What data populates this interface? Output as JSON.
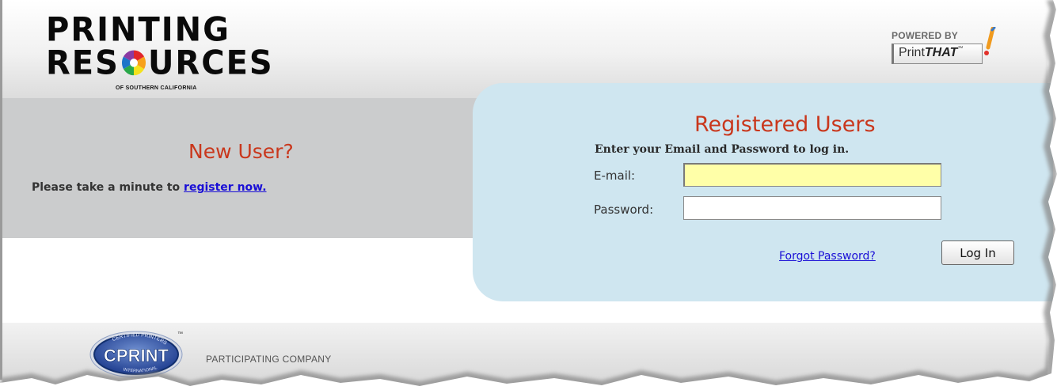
{
  "header": {
    "logo": {
      "line1": "PRINTING",
      "line2_left": "RES",
      "line2_right": "URCES",
      "subtitle": "OF SOUTHERN CALIFORNIA"
    },
    "powered_by": {
      "label": "POWERED BY",
      "brand_regular": "Print",
      "brand_bold": "THAT",
      "trademark": "™"
    }
  },
  "new_user": {
    "title": "New User?",
    "prompt_text": "Please take a minute to ",
    "register_link": "register now."
  },
  "login": {
    "title": "Registered Users",
    "instructions": "Enter your Email and Password to log in.",
    "email_label": "E-mail:",
    "email_value": "",
    "password_label": "Password:",
    "password_value": "",
    "forgot_link": "Forgot Password?",
    "submit_label": "Log In"
  },
  "footer": {
    "cprint_logo_text": "CPRINT",
    "cprint_arc_text": "CERTIFIED PRINTERS",
    "cprint_bottom_text": "INTERNATIONAL",
    "cprint_tm": "™",
    "participating_label": "PARTICIPATING COMPANY"
  },
  "colors": {
    "heading_red": "#c9371c",
    "link_blue": "#1a0fd6",
    "login_panel_bg": "#cfe6f0",
    "new_user_band_bg": "#cbcccd",
    "email_field_bg": "#ffffa8"
  },
  "icons": {
    "logo_color_wheel": "color-wheel-icon",
    "printthat_mark": "exclamation-brush-icon"
  }
}
